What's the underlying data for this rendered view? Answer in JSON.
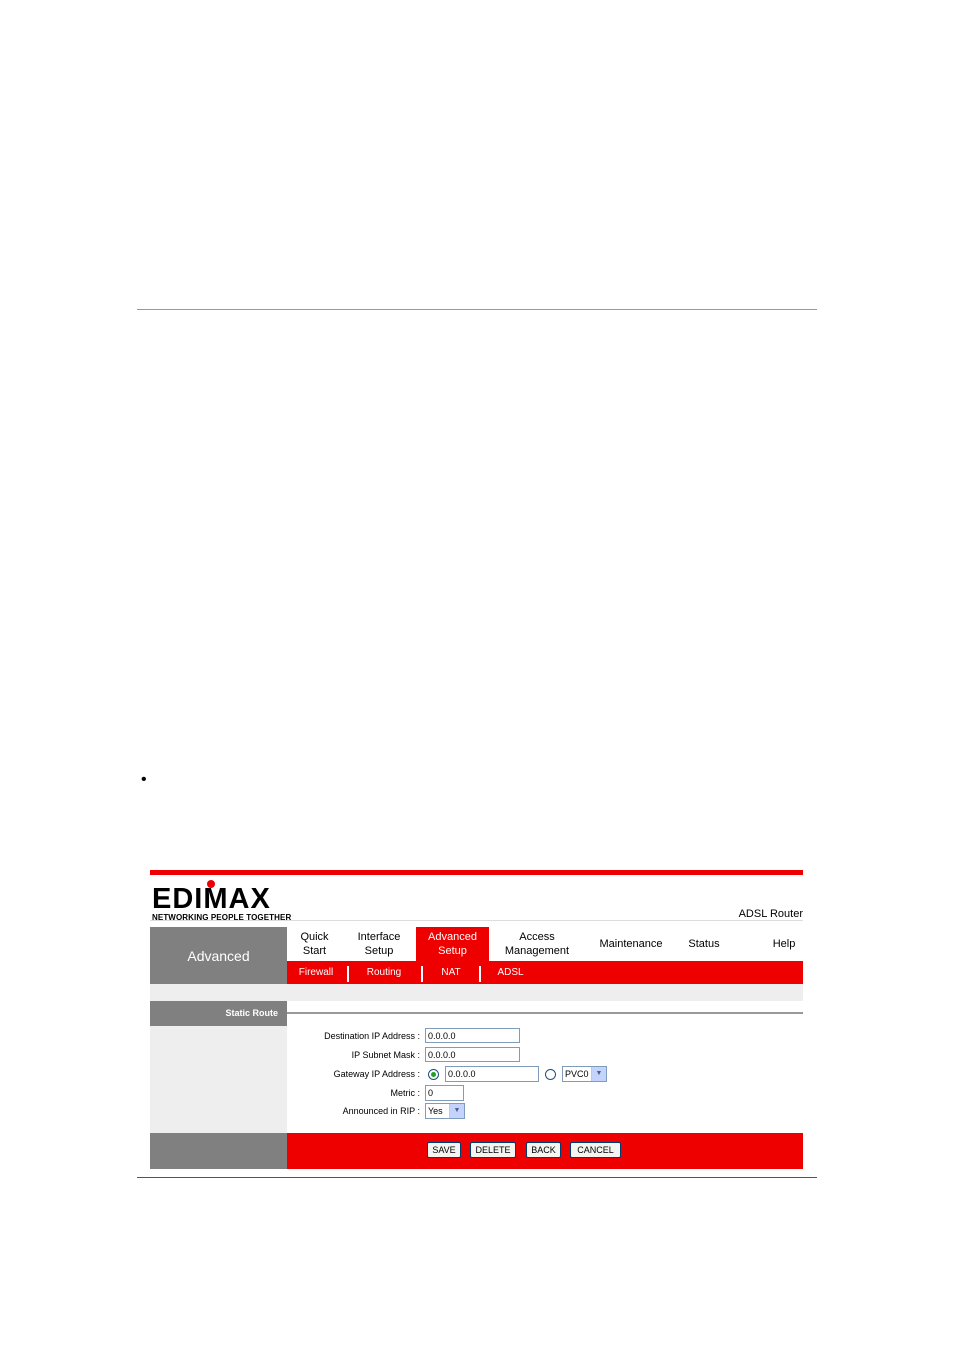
{
  "doc": {
    "bullet": "•"
  },
  "brand": {
    "logo_main": "EDIMAX",
    "logo_sub": "NETWORKING PEOPLE TOGETHER",
    "model": "ADSL Router"
  },
  "section_title": "Advanced",
  "nav": [
    {
      "label": "Quick Start",
      "active": false
    },
    {
      "label": "Interface Setup",
      "active": false
    },
    {
      "label": "Advanced Setup",
      "active": true
    },
    {
      "label": "Access Management",
      "active": false
    },
    {
      "label": "Maintenance",
      "active": false
    },
    {
      "label": "Status",
      "active": false
    },
    {
      "label": "Help",
      "active": false
    }
  ],
  "subnav": [
    "Firewall",
    "Routing",
    "NAT",
    "ADSL"
  ],
  "panel": {
    "title": "Static Route"
  },
  "form": {
    "dest_ip": {
      "label": "Destination IP Address :",
      "value": "0.0.0.0"
    },
    "subnet": {
      "label": "IP Subnet Mask :",
      "value": "0.0.0.0"
    },
    "gateway": {
      "label": "Gateway IP Address :",
      "value": "0.0.0.0",
      "pvc_value": "PVC0",
      "selected": "ip"
    },
    "metric": {
      "label": "Metric :",
      "value": "0"
    },
    "rip": {
      "label": "Announced in RIP :",
      "value": "Yes"
    }
  },
  "buttons": {
    "save": "SAVE",
    "delete": "DELETE",
    "back": "BACK",
    "cancel": "CANCEL"
  },
  "colors": {
    "accent": "#ee0000",
    "panel_grey": "#808080",
    "light_grey": "#eeeeee"
  }
}
